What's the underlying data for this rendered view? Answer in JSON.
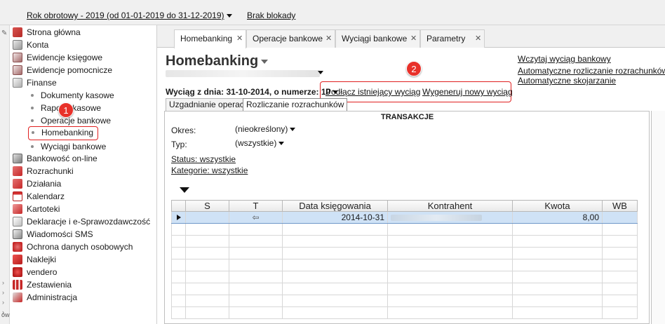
{
  "topbar": {
    "fiscal_year": "Rok obrotowy - 2019  (od 01-01-2019 do 31-12-2019)",
    "lock_status": "Brak blokady"
  },
  "sidebar": {
    "items": [
      {
        "label": "Strona główna",
        "icon": "home-icon"
      },
      {
        "label": "Konta",
        "icon": "accounts-icon"
      },
      {
        "label": "Ewidencje księgowe",
        "icon": "ledger-icon"
      },
      {
        "label": "Ewidencje pomocnicze",
        "icon": "aux-register-icon"
      },
      {
        "label": "Finanse",
        "icon": "finance-icon"
      },
      {
        "label": "Dokumenty kasowe",
        "icon": "bullet"
      },
      {
        "label": "Raporty kasowe",
        "icon": "bullet"
      },
      {
        "label": "Operacje bankowe",
        "icon": "bullet"
      },
      {
        "label": "Homebanking",
        "icon": "bullet"
      },
      {
        "label": "Wyciągi bankowe",
        "icon": "bullet"
      },
      {
        "label": "Bankowość on-line",
        "icon": "online-banking-icon"
      },
      {
        "label": "Rozrachunki",
        "icon": "settlements-icon"
      },
      {
        "label": "Działania",
        "icon": "actions-icon"
      },
      {
        "label": "Kalendarz",
        "icon": "calendar-icon"
      },
      {
        "label": "Kartoteki",
        "icon": "card-index-icon"
      },
      {
        "label": "Deklaracje i e-Sprawozdawczość",
        "icon": "declarations-icon"
      },
      {
        "label": "Wiadomości SMS",
        "icon": "sms-icon"
      },
      {
        "label": "Ochrona danych osobowych",
        "icon": "data-protection-icon"
      },
      {
        "label": "Naklejki",
        "icon": "labels-icon"
      },
      {
        "label": "vendero",
        "icon": "vendero-icon"
      },
      {
        "label": "Zestawienia",
        "icon": "reports-icon"
      },
      {
        "label": "Administracja",
        "icon": "admin-icon"
      }
    ],
    "left_strip_text": "ów"
  },
  "markers": {
    "one": "1",
    "two": "2"
  },
  "tabs": [
    {
      "label": "Homebanking",
      "close": "✕"
    },
    {
      "label": "Operacje bankowe",
      "close": "✕"
    },
    {
      "label": "Wyciągi bankowe",
      "close": "✕"
    },
    {
      "label": "Parametry",
      "close": "✕"
    }
  ],
  "main": {
    "title": "Homebanking",
    "right_links": [
      "Wczytaj wyciąg bankowy",
      "Automatyczne rozliczanie rozrachunków",
      "Automatyczne skojarzanie"
    ],
    "statement_label": "Wyciąg z dnia: 31-10-2014, o numerze: 10",
    "action_links": [
      "Podłącz istniejący wyciąg",
      "Wygeneruj nowy wyciąg"
    ],
    "inner_tabs": [
      "Uzgadnianie operacji",
      "Rozliczanie rozrachunków"
    ],
    "section_title": "TRANSAKCJE",
    "filters": {
      "okres_label": "Okres:",
      "okres_value": "(nieokreślony)",
      "typ_label": "Typ:",
      "typ_value": "(wszystkie)",
      "status_link": "Status: wszystkie",
      "kategorie_link": "Kategorie: wszystkie"
    },
    "grid": {
      "columns": [
        "S",
        "T",
        "Data księgowania",
        "Kontrahent",
        "Kwota",
        "WB"
      ],
      "rows": [
        {
          "s": "",
          "t": "⇦",
          "date": "2014-10-31",
          "kontrahent": "",
          "kwota": "8,00",
          "wb": ""
        }
      ]
    }
  }
}
